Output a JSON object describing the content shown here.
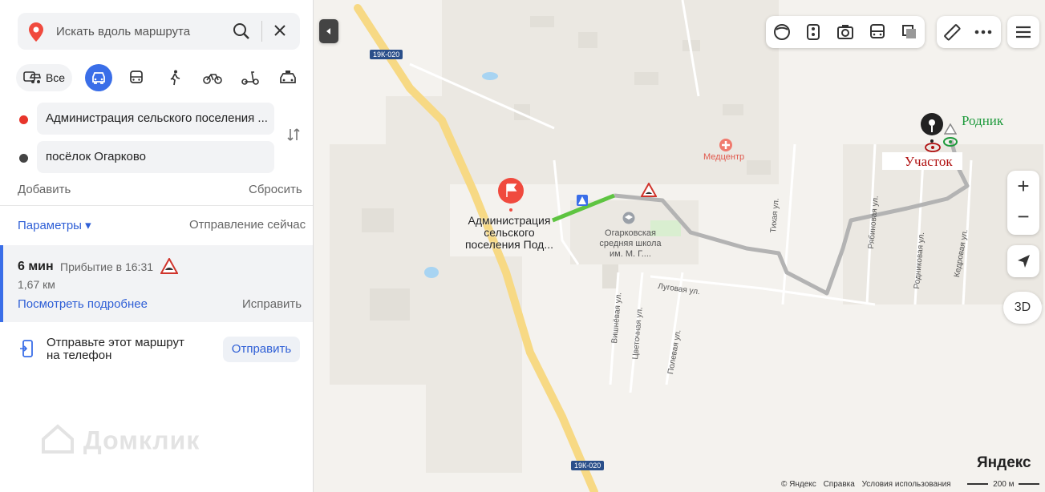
{
  "search": {
    "placeholder": "Искать вдоль маршрута"
  },
  "modes": {
    "all_label": "Все"
  },
  "points": {
    "from": "Администрация сельского поселения ...",
    "to": "посёлок Огарково"
  },
  "actions": {
    "add": "Добавить",
    "reset": "Сбросить"
  },
  "params": {
    "label": "Параметры ▾",
    "departure": "Отправление сейчас"
  },
  "route": {
    "time": "6 мин",
    "arrival": "Прибытие в 16:31",
    "distance": "1,67 км",
    "details": "Посмотреть подробнее",
    "fix": "Исправить"
  },
  "send": {
    "text_line1": "Отправьте этот маршрут",
    "text_line2": "на телефон",
    "button": "Отправить"
  },
  "watermark": "Домклик",
  "map": {
    "road_badge_top": "19К-020",
    "road_badge_bottom": "19К-020",
    "admin_label_1": "Администрация",
    "admin_label_2": "сельского",
    "admin_label_3": "поселения Под...",
    "medcenter": "Медцентр",
    "school_1": "Огарковская",
    "school_2": "средняя школа",
    "school_3": "им. М. Г....",
    "plot_label": "Участок",
    "spring_label": "Родник",
    "streets": {
      "tikhaya": "Тихая ул.",
      "ryabinovaya": "Рябиновая ул.",
      "rodnikovaya": "Родниковая ул.",
      "kedrovaya": "Кедровая ул.",
      "lugovaya": "Луговая ул.",
      "vishnevaya": "Вишнёвая ул.",
      "tsvetochnaya": "Цветочная ул.",
      "polevaya": "Полевая ул."
    },
    "zoom_in": "+",
    "zoom_out": "−",
    "view_3d": "3D",
    "brand": "Яндекс",
    "footer_copyright": "© Яндекс",
    "footer_help": "Справка",
    "footer_terms": "Условия использования",
    "scale": "200 м",
    "colors": {
      "route_main": "#b3b3b3",
      "route_green": "#5ec441",
      "road": "#f7d984",
      "accent": "#3a6ee8"
    }
  }
}
